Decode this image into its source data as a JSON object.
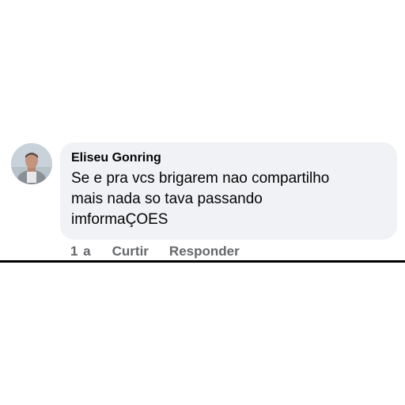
{
  "comment": {
    "author": "Eliseu Gonring",
    "text_lines": [
      "Se e pra vcs brigarem nao compartilho",
      "mais nada so tava passando",
      "imformaÇOES"
    ],
    "time": "1 a",
    "like_label": "Curtir",
    "reply_label": "Responder",
    "avatar_icon": "user-photo-avatar"
  },
  "colors": {
    "bubble_bg": "#f0f2f5",
    "text": "#050505",
    "secondary_text": "#65676b"
  }
}
